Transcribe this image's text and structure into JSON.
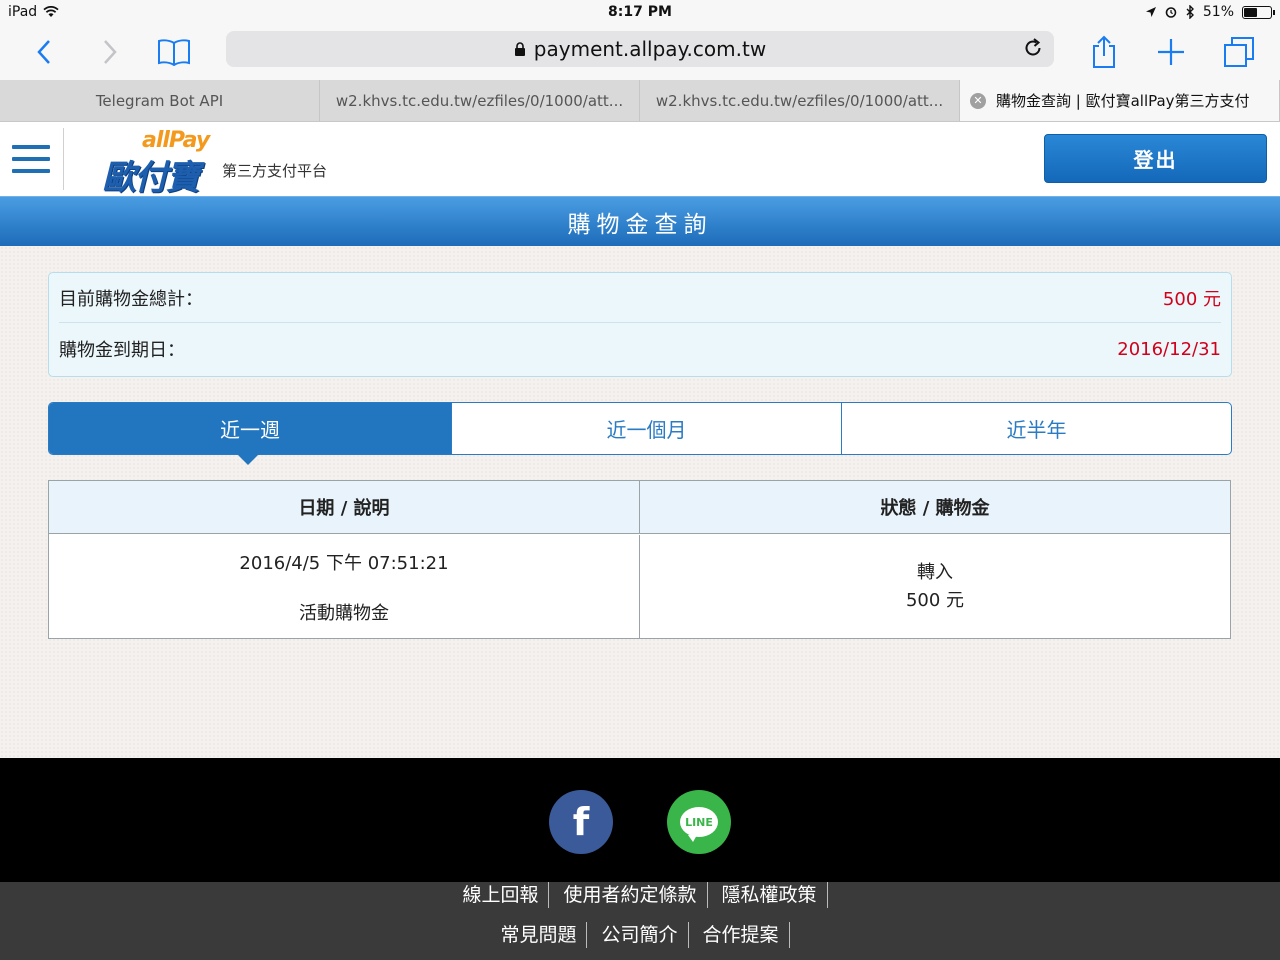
{
  "status_bar": {
    "device": "iPad",
    "time": "8:17 PM",
    "battery": "51%",
    "battery_level": 0.51
  },
  "browser": {
    "url": "payment.allpay.com.tw",
    "tabs": [
      {
        "label": "Telegram Bot API"
      },
      {
        "label": "w2.khvs.tc.edu.tw/ezfiles/0/1000/att..."
      },
      {
        "label": "w2.khvs.tc.edu.tw/ezfiles/0/1000/att..."
      },
      {
        "label": "購物金查詢 | 歐付寶allPay第三方支付"
      }
    ]
  },
  "header": {
    "logo_en": "allPay",
    "logo_zh": "歐付寶",
    "tagline": "第三方支付平台",
    "logout_label": "登出"
  },
  "page_title": "購物金查詢",
  "summary": {
    "total_label": "目前購物金總計：",
    "total_value": "500 元",
    "expiry_label": "購物金到期日：",
    "expiry_value": "2016/12/31"
  },
  "period_tabs": [
    {
      "label": "近一週",
      "active": true
    },
    {
      "label": "近一個月",
      "active": false
    },
    {
      "label": "近半年",
      "active": false
    }
  ],
  "records": {
    "headers": [
      "日期 / 說明",
      "狀態 / 購物金"
    ],
    "rows": [
      {
        "datetime": "2016/4/5 下午 07:51:21",
        "description": "活動購物金",
        "status": "轉入",
        "amount": "500 元"
      }
    ]
  },
  "footer": {
    "social": [
      "facebook-icon",
      "line-icon"
    ],
    "line_icon_text": "LINE",
    "facebook_icon_text": "f",
    "links_row1": [
      "線上回報",
      "使用者約定條款",
      "隱私權政策"
    ],
    "links_row2": [
      "常見問題",
      "公司簡介",
      "合作提案"
    ]
  },
  "colors": {
    "brand_blue": "#1f6fb5",
    "accent_red": "#d0021b",
    "logo_orange": "#f39a1e",
    "line_green": "#39b54a",
    "facebook_blue": "#3b5a9a"
  }
}
